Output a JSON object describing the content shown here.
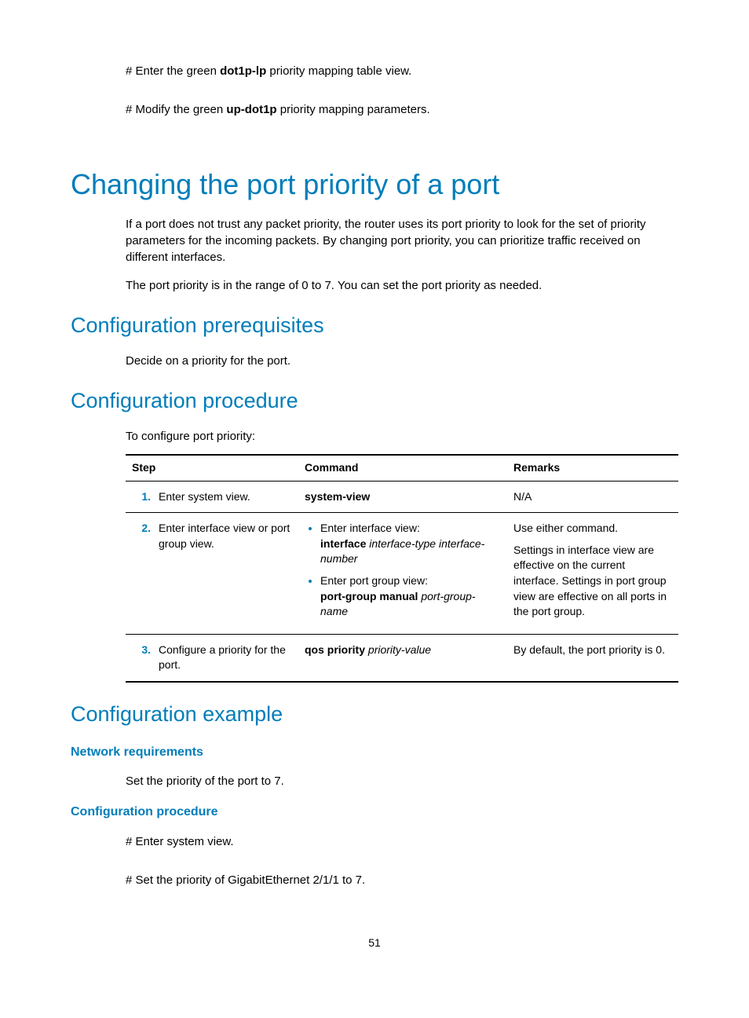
{
  "intro": {
    "line1_prefix": "# Enter the green ",
    "line1_bold": "dot1p-lp",
    "line1_suffix": " priority mapping table view.",
    "line2_prefix": "# Modify the green ",
    "line2_bold": "up-dot1p",
    "line2_suffix": " priority mapping parameters."
  },
  "h1": "Changing the port priority of a port",
  "h1_para1": "If a port does not trust any packet priority, the router uses its port priority to look for the set of priority parameters for the incoming packets. By changing port priority, you can prioritize traffic received on different interfaces.",
  "h1_para2": "The port priority is in the range of 0 to 7. You can set the port priority as needed.",
  "prereq": {
    "heading": "Configuration prerequisites",
    "text": "Decide on a priority for the port."
  },
  "procedure": {
    "heading": "Configuration procedure",
    "intro": "To configure port priority:",
    "headers": {
      "step": "Step",
      "command": "Command",
      "remarks": "Remarks"
    },
    "rows": [
      {
        "num": "1.",
        "desc": "Enter system view.",
        "cmd_bold": "system-view",
        "remarks": "N/A"
      },
      {
        "num": "2.",
        "desc": "Enter interface view or port group view.",
        "bullets": [
          {
            "line1": "Enter interface view:",
            "line2_bold": "interface",
            "line2_italic": " interface-type interface-number"
          },
          {
            "line1": "Enter port group view:",
            "line2_bold": "port-group manual",
            "line2_italic": " port-group-name"
          }
        ],
        "remarks_lines": [
          "Use either command.",
          "Settings in interface view are effective on the current interface. Settings in port group view are effective on all ports in the port group."
        ]
      },
      {
        "num": "3.",
        "desc": "Configure a priority for the port.",
        "cmd_bold": "qos priority",
        "cmd_italic": " priority-value",
        "remarks": "By default, the port priority is 0."
      }
    ]
  },
  "example": {
    "heading": "Configuration example",
    "netreq_heading": "Network requirements",
    "netreq_text": "Set the priority of the port to 7.",
    "proc_heading": "Configuration procedure",
    "proc_line1": "# Enter system view.",
    "proc_line2": "# Set the priority of GigabitEthernet 2/1/1 to 7."
  },
  "page": "51"
}
